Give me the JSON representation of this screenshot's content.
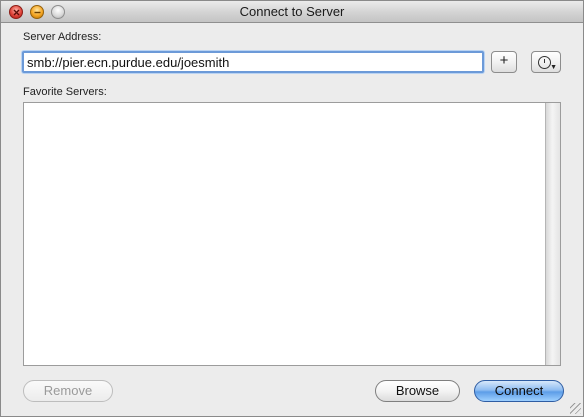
{
  "window": {
    "title": "Connect to Server",
    "controls": [
      "close",
      "minimize",
      "zoom"
    ]
  },
  "server_address": {
    "label": "Server Address:",
    "value": "smb://pier.ecn.purdue.edu/joesmith"
  },
  "buttons": {
    "add": "+",
    "recent_servers_icon": "clock-icon",
    "remove": "Remove",
    "browse": "Browse",
    "connect": "Connect"
  },
  "favorites": {
    "label": "Favorite Servers:",
    "items": []
  },
  "colors": {
    "focus_ring": "#6c9ad8",
    "connect_button": "#5d9de8"
  }
}
